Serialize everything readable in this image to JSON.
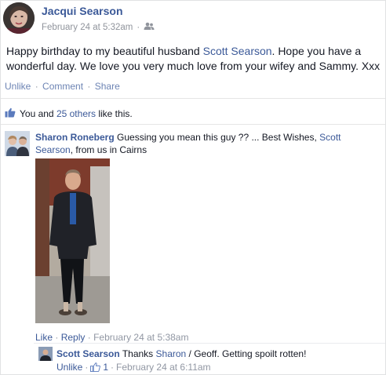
{
  "post": {
    "author": "Jacqui Searson",
    "timestamp": "February 24 at 5:32am",
    "audience_icon": "friends-icon",
    "text_before": "Happy birthday to my beautiful husband ",
    "tagged_name": "Scott Searson",
    "text_after": ". Hope you have a wonderful day. We love you very much love from your wifey and Sammy. Xxx",
    "actions": {
      "unlike": "Unlike",
      "comment": "Comment",
      "share": "Share",
      "separator": "·"
    },
    "likes": {
      "you_and": "You and",
      "others_link": "25 others",
      "suffix": "like this."
    }
  },
  "comment": {
    "author": "Sharon Roneberg",
    "text_before": " Guessing you mean this guy ?? ... Best Wishes, ",
    "tagged_name": "Scott Searson",
    "text_after": ", from us in Cairns",
    "actions": {
      "like": "Like",
      "reply": "Reply",
      "timestamp": "February 24 at 5:38am",
      "separator": "·"
    }
  },
  "reply": {
    "author": "Scott Searson",
    "text_before": " Thanks ",
    "tagged_name": "Sharon",
    "text_after": " / Geoff. Getting spoilt rotten!",
    "actions": {
      "unlike": "Unlike",
      "like_count": "1",
      "timestamp": "February 24 at 6:11am",
      "separator": "·"
    }
  },
  "colors": {
    "link": "#3b5998",
    "meta": "#90949c",
    "text": "#141823"
  }
}
